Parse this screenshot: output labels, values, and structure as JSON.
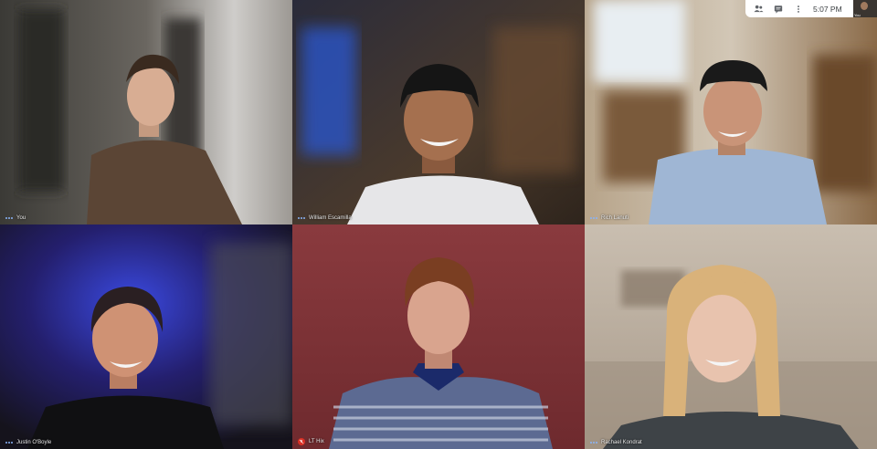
{
  "topbar": {
    "time": "5:07 PM",
    "self_label": "You",
    "icons": [
      "people-icon",
      "chat-icon",
      "more-icon"
    ]
  },
  "participants": [
    {
      "name": "You",
      "muted": false
    },
    {
      "name": "William Escamilla",
      "muted": false
    },
    {
      "name": "Rich Lanuti",
      "muted": false
    },
    {
      "name": "Justin O'Boyle",
      "muted": false
    },
    {
      "name": "LT Hix",
      "muted": true
    },
    {
      "name": "Rachael Kondrat",
      "muted": false
    }
  ],
  "colors": {
    "accent": "#8ab4f8",
    "mute": "#d93025"
  }
}
